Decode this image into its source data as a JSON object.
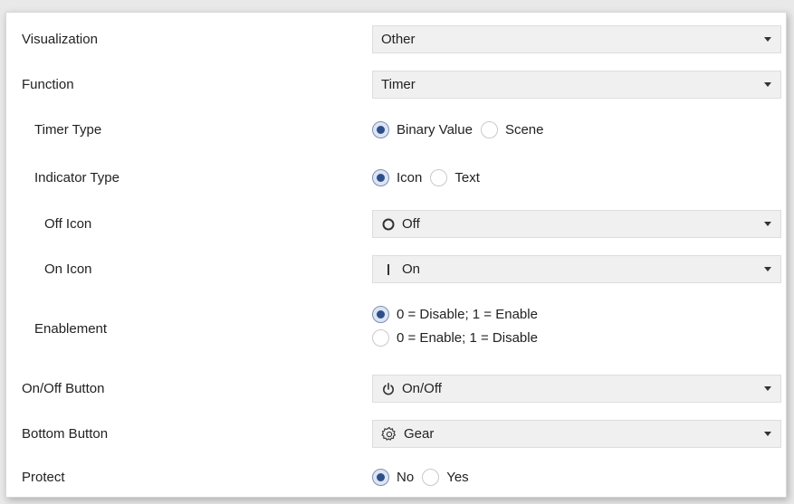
{
  "rows": {
    "visualization": {
      "label": "Visualization",
      "value": "Other"
    },
    "function": {
      "label": "Function",
      "value": "Timer"
    },
    "timer_type": {
      "label": "Timer Type",
      "options": [
        "Binary Value",
        "Scene"
      ],
      "selected": 0
    },
    "indicator_type": {
      "label": "Indicator Type",
      "options": [
        "Icon",
        "Text"
      ],
      "selected": 0
    },
    "off_icon": {
      "label": "Off Icon",
      "value": "Off",
      "icon": "circle-outline-icon"
    },
    "on_icon": {
      "label": "On Icon",
      "value": "On",
      "icon": "vertical-bar-icon"
    },
    "enablement": {
      "label": "Enablement",
      "options": [
        "0 = Disable; 1 = Enable",
        "0 = Enable; 1 = Disable"
      ],
      "selected": 0
    },
    "onoff_button": {
      "label": "On/Off Button",
      "value": "On/Off",
      "icon": "power-icon"
    },
    "bottom_button": {
      "label": "Bottom Button",
      "value": "Gear",
      "icon": "gear-icon"
    },
    "protect": {
      "label": "Protect",
      "options": [
        "No",
        "Yes"
      ],
      "selected": 0
    }
  },
  "colors": {
    "radio_selected": "#2c4f8c",
    "dropdown_bg": "#f0f0f0"
  }
}
